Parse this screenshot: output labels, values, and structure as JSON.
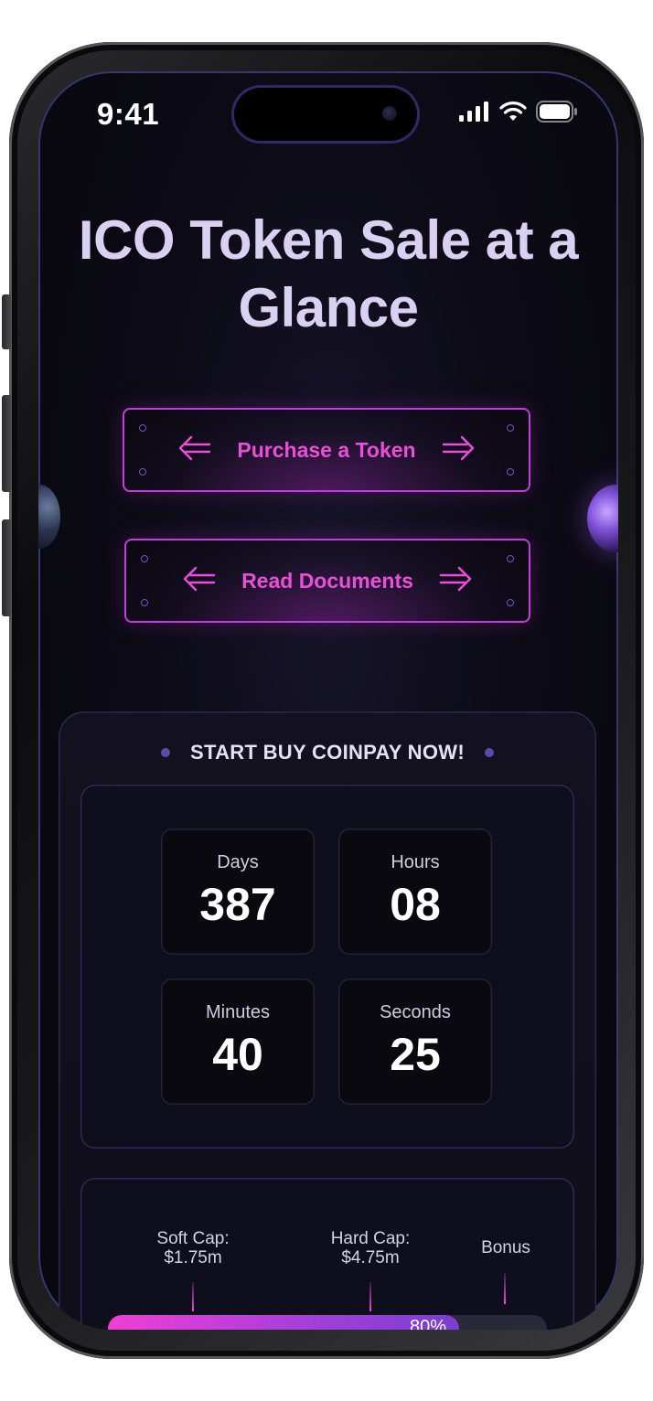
{
  "status_bar": {
    "time": "9:41"
  },
  "hero": {
    "title_line1": "ICO Token Sale at a",
    "title_line2": "Glance"
  },
  "buttons": {
    "purchase": "Purchase a Token",
    "documents": "Read Documents"
  },
  "countdown": {
    "heading": "START BUY COINPAY NOW!",
    "days_label": "Days",
    "days_value": "387",
    "hours_label": "Hours",
    "hours_value": "08",
    "minutes_label": "Minutes",
    "minutes_value": "40",
    "seconds_label": "Seconds",
    "seconds_value": "25"
  },
  "caps": {
    "soft_cap_label": "Soft Cap:",
    "soft_cap_value": "$1.75m",
    "hard_cap_label": "Hard Cap:",
    "hard_cap_value": "$4.75m",
    "bonus_label": "Bonus",
    "progress_text": "80%",
    "progress_fraction": 0.8
  },
  "colors": {
    "accent": "#e94fd8",
    "title": "#d8d1f2",
    "border": "#c13de0"
  }
}
